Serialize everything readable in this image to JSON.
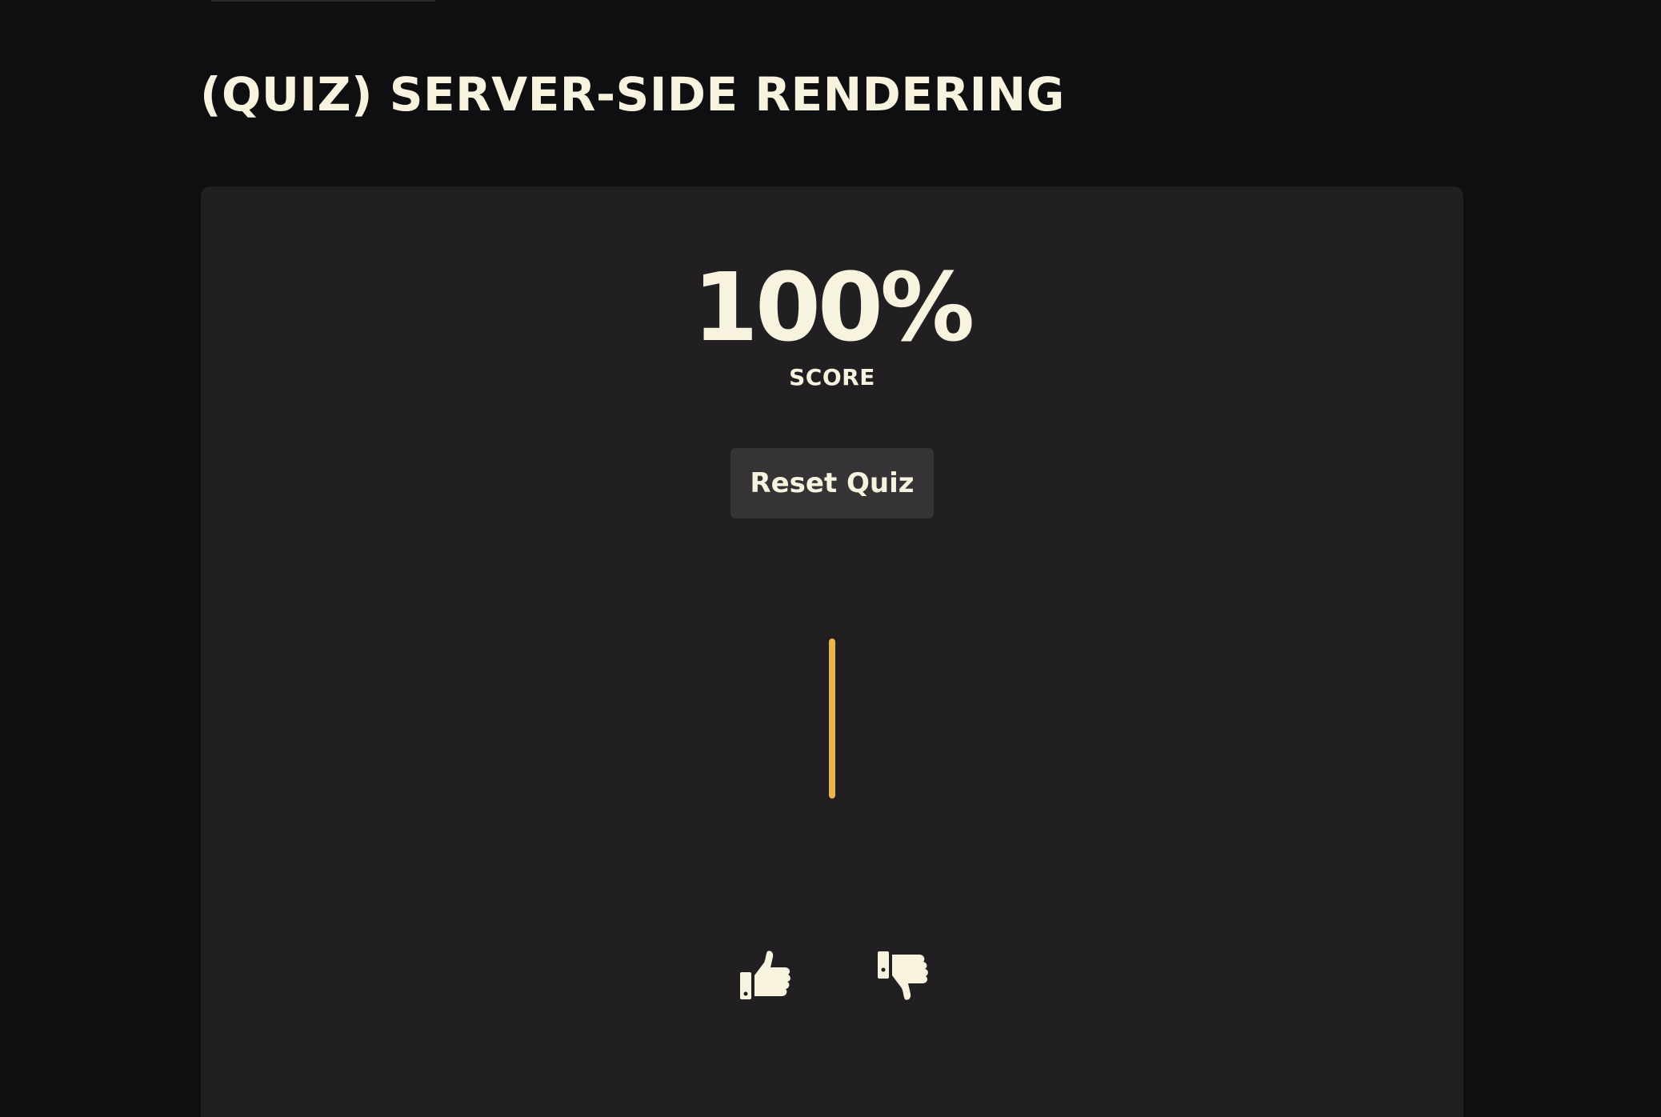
{
  "page": {
    "title": "(QUIZ) SERVER-SIDE RENDERING"
  },
  "quiz": {
    "score_value": "100%",
    "score_label": "SCORE",
    "reset_label": "Reset Quiz",
    "progress_fraction": 1.0,
    "accent_color": "#e8b54a"
  },
  "feedback": {
    "icons": [
      "thumbs-up-icon",
      "thumbs-down-icon"
    ]
  },
  "colors": {
    "background": "#0f0e10",
    "card": "#211f21",
    "text": "#f7f3df",
    "button": "#353335"
  }
}
